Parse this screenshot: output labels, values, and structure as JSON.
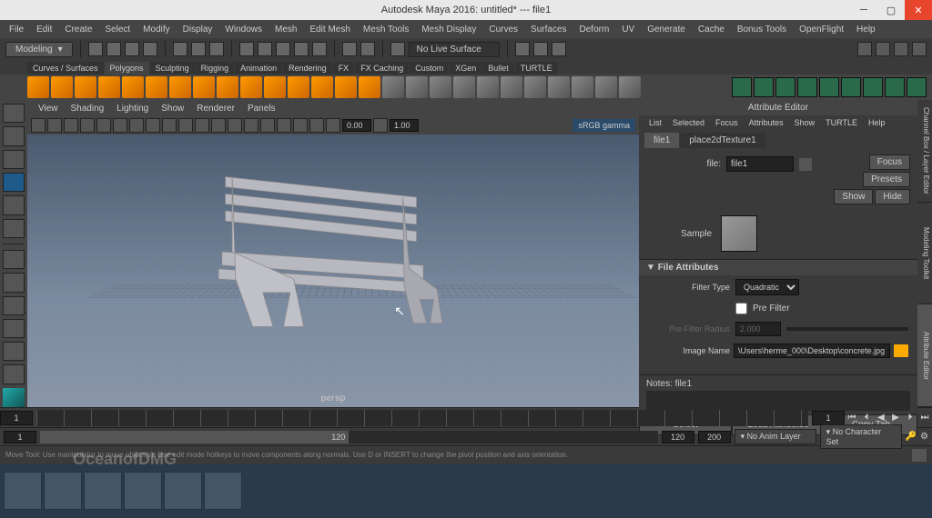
{
  "title": "Autodesk Maya 2016: untitled*   ---   file1",
  "menus": [
    "File",
    "Edit",
    "Create",
    "Select",
    "Modify",
    "Display",
    "Windows",
    "Mesh",
    "Edit Mesh",
    "Mesh Tools",
    "Mesh Display",
    "Curves",
    "Surfaces",
    "Deform",
    "UV",
    "Generate",
    "Cache",
    "Bonus Tools",
    "OpenFlight",
    "Help"
  ],
  "mode": "Modeling",
  "nolive": "No Live Surface",
  "shelftabs": [
    "Curves / Surfaces",
    "Polygons",
    "Sculpting",
    "Rigging",
    "Animation",
    "Rendering",
    "FX",
    "FX Caching",
    "Custom",
    "XGen",
    "Bullet",
    "TURTLE"
  ],
  "shelftab_active": 1,
  "viewmenu": [
    "View",
    "Shading",
    "Lighting",
    "Show",
    "Renderer",
    "Panels"
  ],
  "viewnum1": "0.00",
  "viewnum2": "1.00",
  "gamma": "sRGB gamma",
  "persp": "persp",
  "attr": {
    "title": "Attribute Editor",
    "menu": [
      "List",
      "Selected",
      "Focus",
      "Attributes",
      "Show",
      "TURTLE",
      "Help"
    ],
    "tabs": [
      "file1",
      "place2dTexture1"
    ],
    "file_label": "file:",
    "file_value": "file1",
    "focus_btn": "Focus",
    "presets_btn": "Presets",
    "show_btn": "Show",
    "hide_btn": "Hide",
    "sample_label": "Sample",
    "section1": "File Attributes",
    "filtertype_label": "Filter Type",
    "filtertype_value": "Quadratic",
    "prefilter_label": "Pre Filter",
    "prefilterradius_label": "Pre Filter Radius",
    "prefilterradius_value": "2.000",
    "imagename_label": "Image Name",
    "imagename_value": "\\Users\\herme_000\\Desktop\\concrete.jpg",
    "notes_label": "Notes: file1",
    "btn_select": "Select",
    "btn_load": "Load Attributes",
    "btn_copy": "Copy Tab"
  },
  "righttabs": [
    "Channel Box / Layer Editor",
    "Modeling Toolkit",
    "Attribute Editor"
  ],
  "timeline": {
    "start": "1",
    "end": "120",
    "rangestart": "1",
    "rangeend": "120",
    "rmax": "200",
    "current": "1",
    "animlayer": "No Anim Layer",
    "charset": "No Character Set"
  },
  "status": "Move Tool: Use manipulator to move object(s). Use edit mode hotkeys to move components along normals. Use D or INSERT to change the pivot position and axis orientation.",
  "watermark": "OceanofDMG"
}
